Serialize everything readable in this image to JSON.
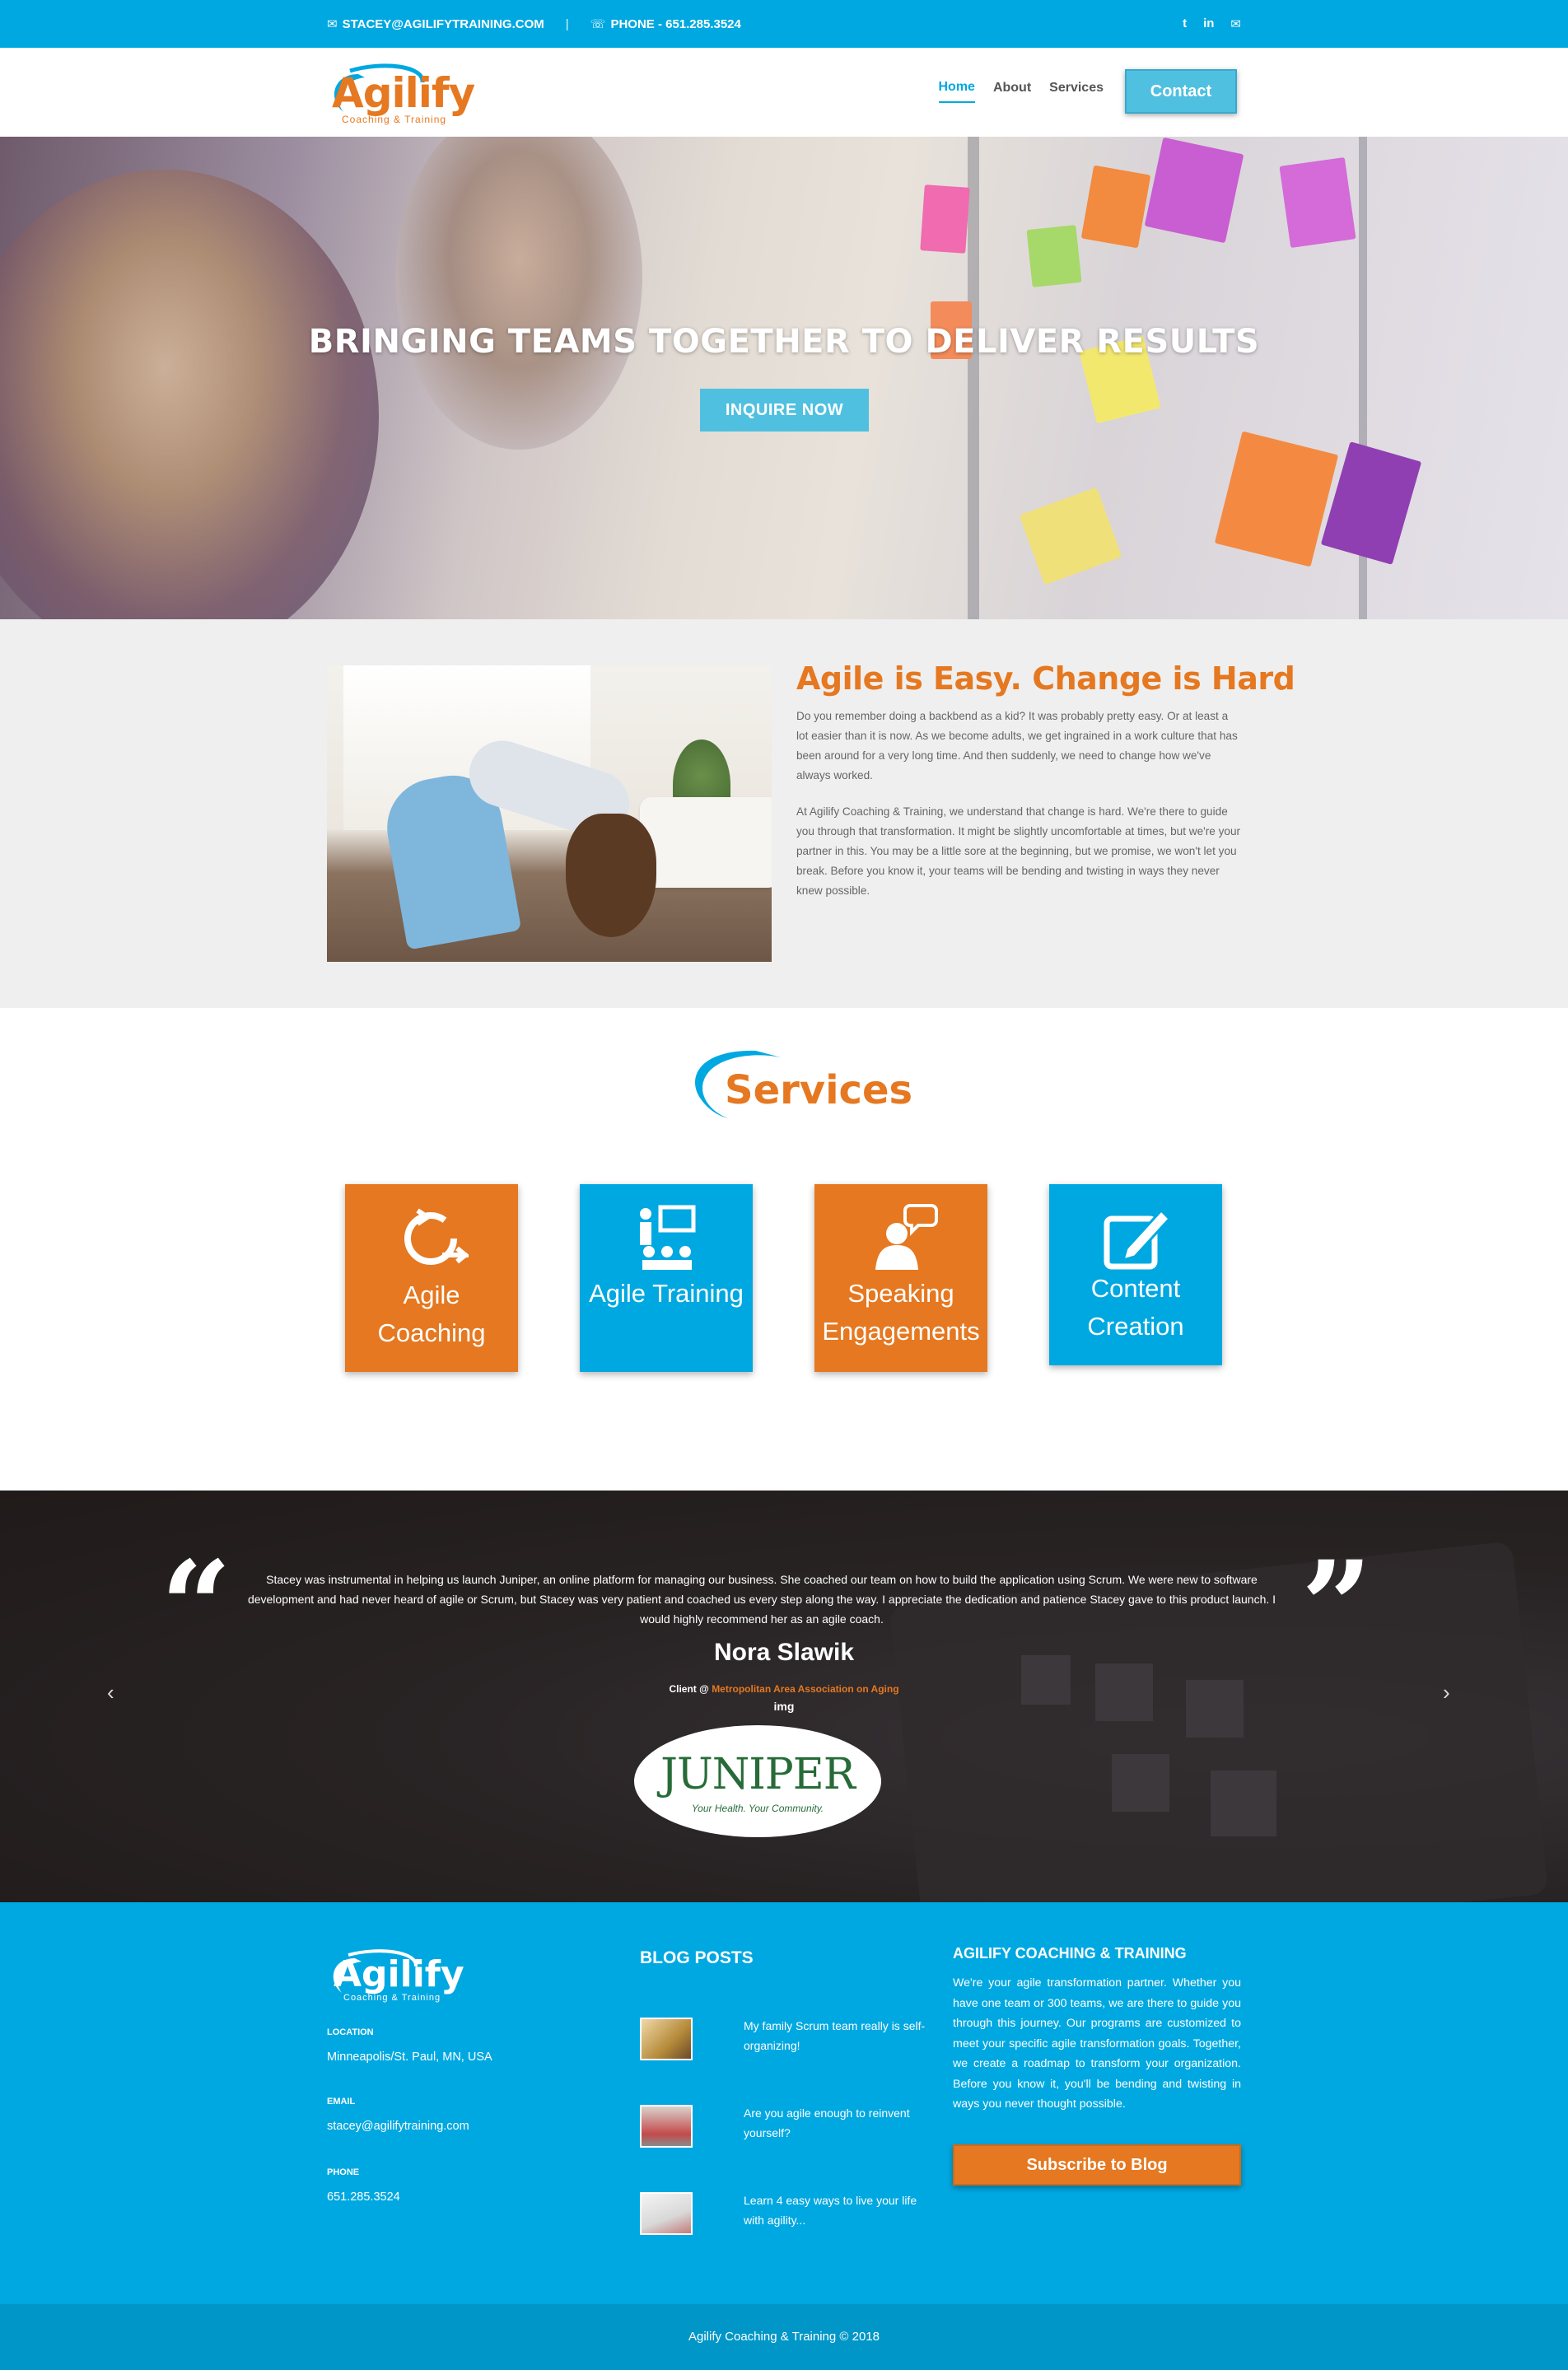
{
  "topbar": {
    "email": "STACEY@AGILIFYTRAINING.COM",
    "separator": "|",
    "phone": "PHONE - 651.285.3524",
    "social": [
      {
        "icon": "twitter-icon",
        "glyph": "t"
      },
      {
        "icon": "linkedin-icon",
        "glyph": "in"
      },
      {
        "icon": "email-icon",
        "glyph": "✉"
      }
    ]
  },
  "brand": {
    "name": "Agilify",
    "tagline": "Coaching & Training",
    "orange": "#e57820",
    "blue": "#00a8e1"
  },
  "nav": {
    "items": [
      "Home",
      "About",
      "Services"
    ],
    "active": "Home",
    "contact": "Contact"
  },
  "hero": {
    "headline": "BRINGING TEAMS TOGETHER TO DELIVER RESULTS",
    "cta": "INQUIRE NOW"
  },
  "about": {
    "title": "Agile is Easy. Change is Hard",
    "p1": "Do you remember doing a backbend as a kid? It was probably pretty easy. Or at least a lot easier than it is now. As we become adults, we get ingrained in a work culture that has been around for a very long time. And then suddenly, we need to change how we've always worked.",
    "p2": "At Agilify Coaching & Training, we understand that change is hard. We're there to guide you through that transformation. It might be slightly uncomfortable at times, but we're your partner in this. You may be a little sore at the beginning, but we promise, we won't let you break. Before you know it, your teams will be bending and twisting in ways they never knew possible."
  },
  "services": {
    "heading": "Services",
    "cards": [
      {
        "label1": "Agile",
        "label2": "Coaching",
        "icon": "agile-cycle-icon",
        "color": "orange"
      },
      {
        "label1": "Agile Training",
        "label2": "",
        "icon": "presentation-icon",
        "color": "blue"
      },
      {
        "label1": "Speaking",
        "label2": "Engagements",
        "icon": "speaker-icon",
        "color": "orange"
      },
      {
        "label1": "Content",
        "label2": "Creation",
        "icon": "edit-icon",
        "color": "blue"
      }
    ]
  },
  "testimonial": {
    "quote": "Stacey was instrumental in helping us launch Juniper, an online platform for managing our business. She coached our team on how to build the application using Scrum. We were new to software development and had never heard of agile or Scrum, but Stacey was very patient and coached us every step along the way. I appreciate the dedication and patience Stacey gave to this product launch. I would highly recommend her as an agile coach.",
    "name": "Nora Slawik",
    "role_prefix": "Client @",
    "org": "Metropolitan Area Association on Aging",
    "img_alt": "img",
    "client_logo": "JUNIPER",
    "client_tagline": "Your Health. Your Community."
  },
  "footer": {
    "location_label": "LOCATION",
    "location": "Minneapolis/St. Paul, MN, USA",
    "email_label": "EMAIL",
    "email": "stacey@agilifytraining.com",
    "phone_label": "PHONE",
    "phone": "651.285.3524",
    "blog_heading": "BLOG POSTS",
    "posts": [
      {
        "title": "My family Scrum team really is self-organizing!"
      },
      {
        "title": "Are you agile enough to reinvent yourself?"
      },
      {
        "title": "Learn 4 easy ways to live your life with agility..."
      }
    ],
    "company_heading": "AGILIFY COACHING & TRAINING",
    "company_text": "We're your agile transformation partner. Whether you have one team or 300 teams, we are there to guide you through this journey. Our programs are customized to meet your specific agile transformation goals. Together, we create a roadmap to transform your organization. Before you know it, you'll be bending and twisting in ways you never thought possible.",
    "subscribe": "Subscribe to Blog",
    "copyright": "Agilify Coaching & Training © 2018"
  }
}
